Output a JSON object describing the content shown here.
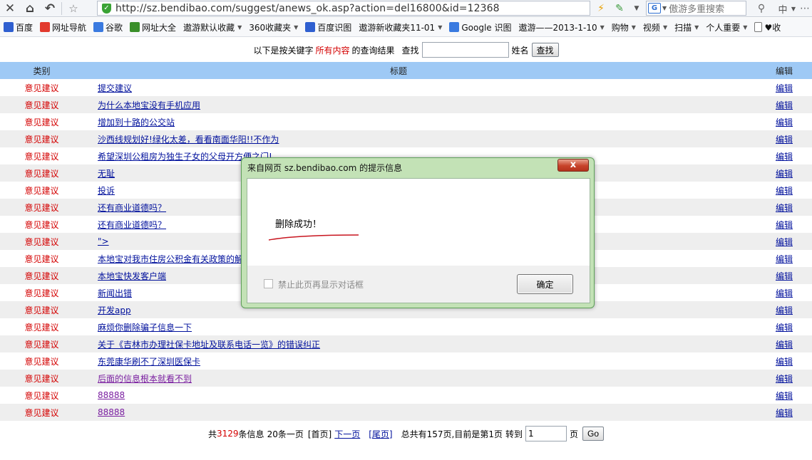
{
  "browser": {
    "url": "http://sz.bendibao.com/suggest/anews_ok.asp?action=del16800&id=12368",
    "search_placeholder": "傲游多重搜索",
    "favorites": [
      {
        "label": "百度",
        "icon": "baidu-paw-icon",
        "color": "#2f5fd0",
        "dropdown": false
      },
      {
        "label": "网址导航",
        "icon": "hao123-icon",
        "color": "#e23a2e",
        "dropdown": false
      },
      {
        "label": "谷歌",
        "icon": "google-icon",
        "color": "#3a7ae0",
        "dropdown": false
      },
      {
        "label": "网址大全",
        "icon": "maxthon-icon",
        "color": "#3a8f2a",
        "dropdown": false
      },
      {
        "label": "遨游默认收藏",
        "icon": "",
        "color": "",
        "dropdown": true
      },
      {
        "label": "360收藏夹",
        "icon": "",
        "color": "",
        "dropdown": true
      },
      {
        "label": "百度识图",
        "icon": "baidu-paw-icon",
        "color": "#2f5fd0",
        "dropdown": false
      },
      {
        "label": "遨游新收藏夹11-01",
        "icon": "",
        "color": "",
        "dropdown": true
      },
      {
        "label": "Google 识图",
        "icon": "google-icon",
        "color": "#3a7ae0",
        "dropdown": false
      },
      {
        "label": "遨游——2013-1-10",
        "icon": "",
        "color": "",
        "dropdown": true
      },
      {
        "label": "购物",
        "icon": "",
        "color": "",
        "dropdown": true
      },
      {
        "label": "视频",
        "icon": "",
        "color": "",
        "dropdown": true
      },
      {
        "label": "扫描",
        "icon": "",
        "color": "",
        "dropdown": true
      },
      {
        "label": "个人重要",
        "icon": "",
        "color": "",
        "dropdown": true
      },
      {
        "label": "♥收",
        "icon": "page-icon",
        "color": "#ffffff",
        "dropdown": false
      }
    ]
  },
  "search": {
    "prefix": "以下是按关键字",
    "highlight": "所有内容",
    "suffix": "的查询结果",
    "find_label": "查找",
    "name_label": "姓名",
    "button": "查找"
  },
  "table": {
    "headers": {
      "category": "类别",
      "title": "标题",
      "edit": "编辑"
    },
    "rows": [
      {
        "category": "意见建议",
        "title": "提交建议",
        "edit": "编辑",
        "visited": false
      },
      {
        "category": "意见建议",
        "title": "为什么本地宝没有手机应用",
        "edit": "编辑",
        "visited": false
      },
      {
        "category": "意见建议",
        "title": "增加到十路的公交站",
        "edit": "编辑",
        "visited": false
      },
      {
        "category": "意见建议",
        "title": "沙西线规划好!绿化太差，看看南面华阳!!不作为",
        "edit": "编辑",
        "visited": false
      },
      {
        "category": "意见建议",
        "title": "希望深圳公租房为独生子女的父母开方便之门!",
        "edit": "编辑",
        "visited": false
      },
      {
        "category": "意见建议",
        "title": "无耻",
        "edit": "编辑",
        "visited": false
      },
      {
        "category": "意见建议",
        "title": "投诉",
        "edit": "编辑",
        "visited": false
      },
      {
        "category": "意见建议",
        "title": "还有商业道德吗？",
        "edit": "编辑",
        "visited": false
      },
      {
        "category": "意见建议",
        "title": "还有商业道德吗？",
        "edit": "编辑",
        "visited": false
      },
      {
        "category": "意见建议",
        "title": "\">",
        "edit": "编辑",
        "visited": false
      },
      {
        "category": "意见建议",
        "title": "本地宝对我市住房公积金有关政策的解读",
        "edit": "编辑",
        "visited": false
      },
      {
        "category": "意见建议",
        "title": "本地宝快发客户端",
        "edit": "编辑",
        "visited": false
      },
      {
        "category": "意见建议",
        "title": "新闻出错",
        "edit": "编辑",
        "visited": false
      },
      {
        "category": "意见建议",
        "title": "开发app",
        "edit": "编辑",
        "visited": false
      },
      {
        "category": "意见建议",
        "title": "麻烦你删除骗子信息一下",
        "edit": "编辑",
        "visited": false
      },
      {
        "category": "意见建议",
        "title": "关于《吉林市办理社保卡地址及联系电话一览》的错误纠正",
        "edit": "编辑",
        "visited": false
      },
      {
        "category": "意见建议",
        "title": "东莞康华刷不了深圳医保卡",
        "edit": "编辑",
        "visited": false
      },
      {
        "category": "意见建议",
        "title": "后面的信息根本就看不到",
        "edit": "编辑",
        "visited": true
      },
      {
        "category": "意见建议",
        "title": "88888",
        "edit": "编辑",
        "visited": true
      },
      {
        "category": "意见建议",
        "title": "88888",
        "edit": "编辑",
        "visited": true
      }
    ]
  },
  "pager": {
    "total_prefix": "共",
    "total_count": "3129",
    "total_suffix": "条信息",
    "per_page": "20条一页",
    "first": "[首页]",
    "next": "下一页",
    "last": "[尾页]",
    "pages_text": "总共有157页,目前是第1页",
    "goto_label": "转到",
    "goto_value": "1",
    "page_unit": "页",
    "go_button": "Go"
  },
  "dialog": {
    "title": "来自网页 sz.bendibao.com 的提示信息",
    "close_symbol": "x",
    "message": "删除成功！",
    "checkbox_label": "禁止此页再显示对话框",
    "ok_button": "确定"
  },
  "colors": {
    "header_blue": "#9ec9f5",
    "category_red": "#d40000",
    "link_blue": "#00109c",
    "visited_purple": "#7a1fa0",
    "dialog_green": "#c3e2b6"
  }
}
